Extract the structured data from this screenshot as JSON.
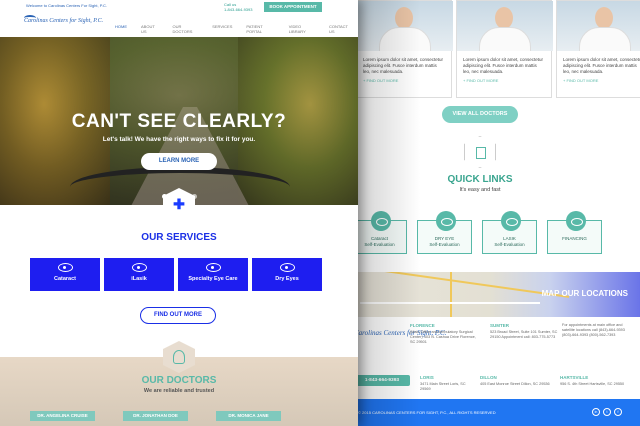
{
  "topbar": {
    "welcome": "Welcome to Carolinas Centers For Sight, P.C.",
    "call_label": "Call us",
    "phone": "1-843-664-9393",
    "book_button": "BOOK APPOINTMENT"
  },
  "logo": {
    "text": "Carolinas Centers for Sight, P.C."
  },
  "nav": {
    "items": [
      "HOME",
      "ABOUT US",
      "OUR DOCTORS",
      "SERVICES",
      "PATIENT PORTAL",
      "VIDEO LIBRARY",
      "CONTACT US"
    ],
    "active": "HOME"
  },
  "hero": {
    "title": "CAN'T SEE CLEARLY?",
    "subtitle": "Let's talk! We have the right ways to fix it for you.",
    "button": "LEARN MORE"
  },
  "services": {
    "title": "OUR SERVICES",
    "items": [
      "Cataract",
      "iLasik",
      "Specialty Eye Care",
      "Dry Eyes"
    ],
    "button": "FIND OUT MORE"
  },
  "doctors": {
    "title": "OUR DOCTORS",
    "subtitle": "We are reliable and trusted",
    "names": [
      "DR. ANGELINA CRUISE",
      "DR. JONATHAN DOE",
      "DR. MONICA JANE"
    ],
    "card_text": "Lorem ipsum dolor sit amet, consectetur adipiscing elit. Fusce interdum mattis leo, nec malesuada.",
    "find_out_more": "+ FIND OUT MORE",
    "view_all": "VIEW ALL DOCTORS"
  },
  "quick_links": {
    "title": "QUICK LINKS",
    "subtitle": "It's easy and fast",
    "items": [
      {
        "line1": "Cataract",
        "line2": "Self-Evaluation"
      },
      {
        "line1": "DRY EYE",
        "line2": "Self-Evaluation"
      },
      {
        "line1": "LASIK",
        "line2": "Self-Evaluation"
      },
      {
        "line1": "FINANCING",
        "line2": ""
      }
    ]
  },
  "map": {
    "label": "MAP OUR LOCATIONS"
  },
  "footer": {
    "logo": "Carolinas Centers for Sight, P.C.",
    "phone": "1-843-664-9393",
    "cols": [
      {
        "name": "FLORENCE",
        "addr": "(Main Office and Ambulatory Surgical Center) 403 N. Cashua Drive Florence, SC 29501"
      },
      {
        "name": "SUMTER",
        "addr": "523 Broad Street, Suite 101 Sumter, SC 29150 Appointment call: 803-775-5773"
      },
      {
        "name": "",
        "addr": "For appointments at main office and satellite locations call (843)-664-9393 (803)-664-9393 (800)-562-7393"
      },
      {
        "name": "LORIS",
        "addr": "3471 Main Street Loris, SC 29569"
      },
      {
        "name": "DILLON",
        "addr": "405 East Monroe Street Dillon, SC 29536"
      },
      {
        "name": "HARTSVILLE",
        "addr": "956 S. 4th Street Hartsville, SC 29550"
      }
    ],
    "copyright": "© 2015 CAROLINAS CENTERS FOR SIGHT, P.C., ALL RIGHTS RESERVED"
  },
  "colors": {
    "primary_blue": "#1e1ef0",
    "teal": "#58b9a8",
    "footer_blue": "#2076f2"
  }
}
